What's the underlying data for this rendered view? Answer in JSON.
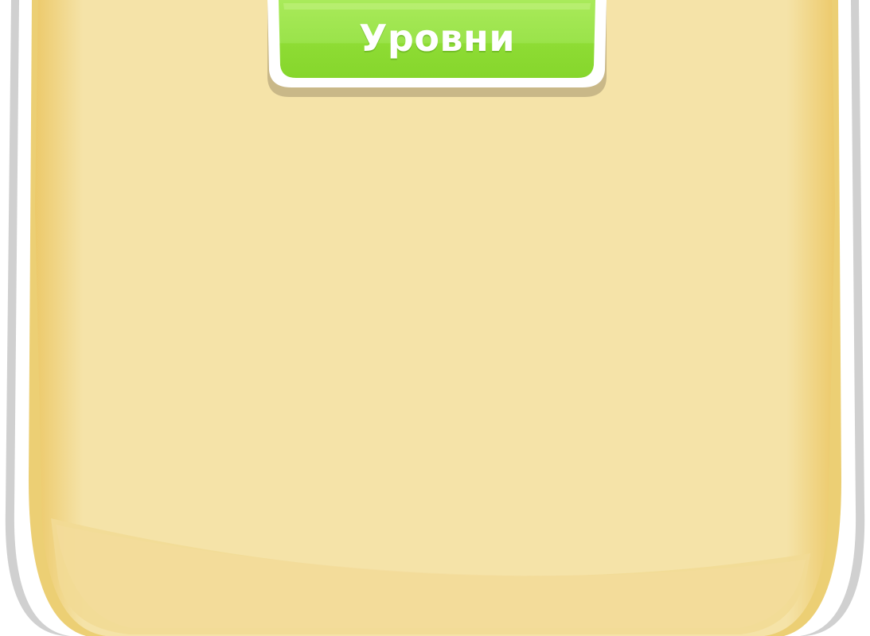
{
  "panel": {
    "title": "Уровни",
    "colors": {
      "frame_outer": "#d4d4d4",
      "frame_white": "#ffffff",
      "panel_fill": "#f5e3a8",
      "panel_edge": "#eccf74",
      "panel_bottom_shade": "#f2dc98",
      "tab_green": "#8ede35",
      "tab_green_light": "#a7e856",
      "tab_shadow": "#c8b888"
    }
  }
}
